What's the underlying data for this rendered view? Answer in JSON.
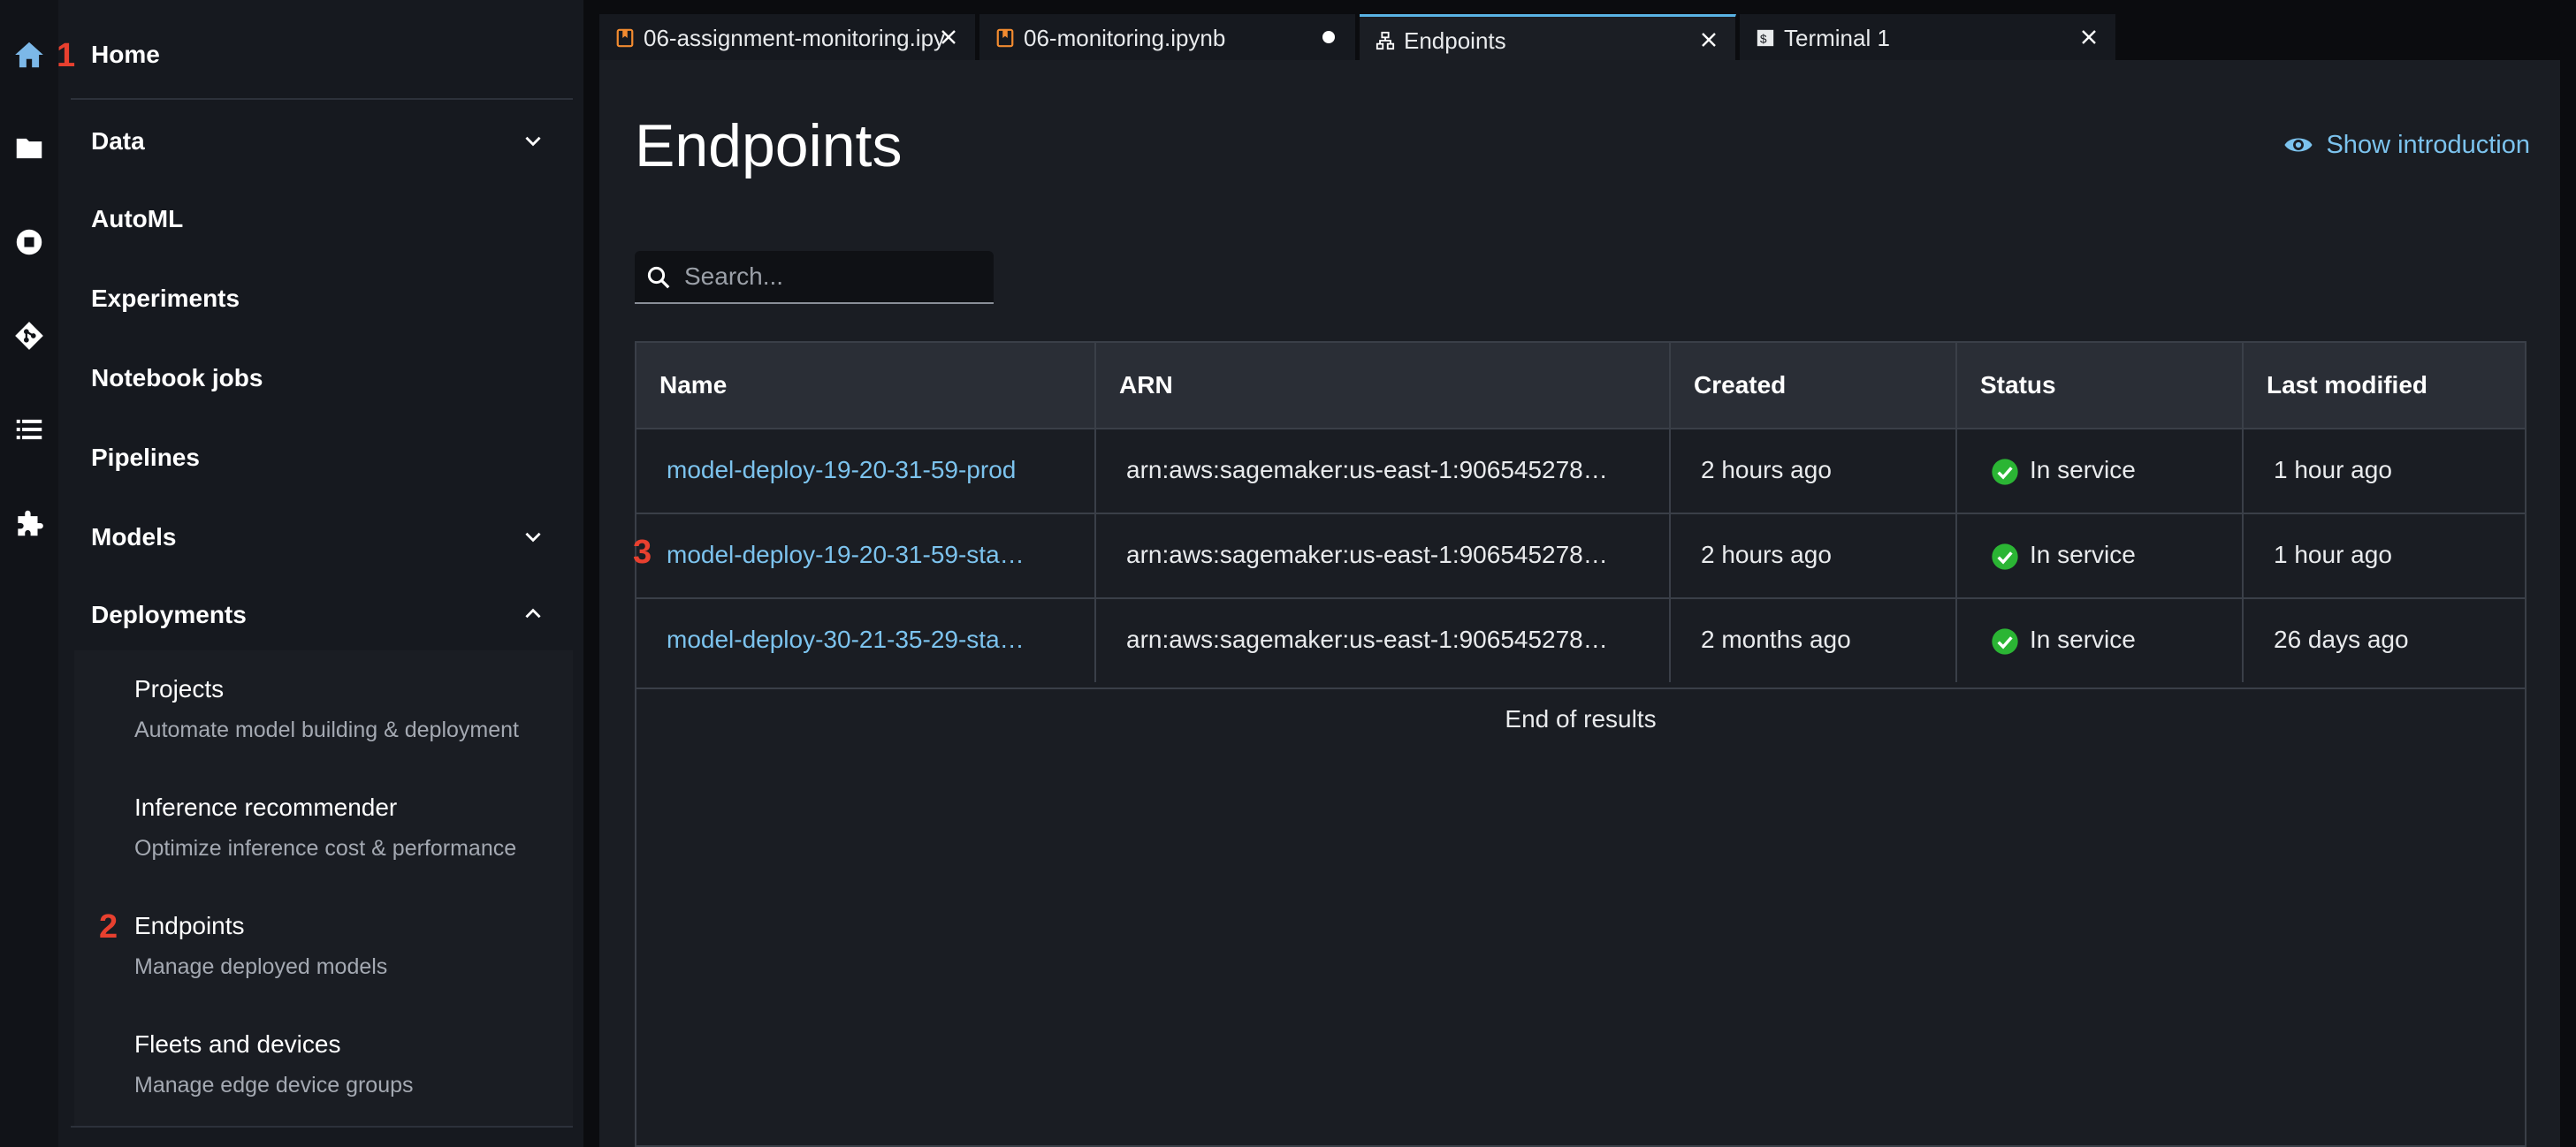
{
  "activity_bar": {
    "icons": [
      "home-icon",
      "folder-icon",
      "running-icon",
      "git-icon",
      "list-icon",
      "extension-icon"
    ]
  },
  "annotations": {
    "one": "1",
    "two": "2",
    "three": "3"
  },
  "sidebar": {
    "home_label": "Home",
    "items": [
      {
        "label": "Data",
        "chevron": "down"
      },
      {
        "label": "AutoML"
      },
      {
        "label": "Experiments"
      },
      {
        "label": "Notebook jobs"
      },
      {
        "label": "Pipelines"
      },
      {
        "label": "Models",
        "chevron": "down"
      },
      {
        "label": "Deployments",
        "chevron": "up"
      }
    ],
    "deployments_sub": [
      {
        "title": "Projects",
        "desc": "Automate model building & deployment"
      },
      {
        "title": "Inference recommender",
        "desc": "Optimize inference cost & performance"
      },
      {
        "title": "Endpoints",
        "desc": "Manage deployed models"
      },
      {
        "title": "Fleets and devices",
        "desc": "Manage edge device groups"
      }
    ]
  },
  "tabs": [
    {
      "label": "06-assignment-monitoring.ipy",
      "icon": "notebook-icon",
      "close": "×"
    },
    {
      "label": "06-monitoring.ipynb",
      "icon": "notebook-icon",
      "close": "●"
    },
    {
      "label": "Endpoints",
      "icon": "endpoints-icon",
      "close": "×",
      "active": true
    },
    {
      "label": "Terminal 1",
      "icon": "terminal-icon",
      "close": "×"
    }
  ],
  "page": {
    "title": "Endpoints",
    "show_intro": "Show introduction",
    "search_placeholder": "Search...",
    "end_of_results": "End of results"
  },
  "table": {
    "columns": [
      "Name",
      "ARN",
      "Created",
      "Status",
      "Last modified"
    ],
    "rows": [
      {
        "name": "model-deploy-19-20-31-59-prod",
        "arn": "arn:aws:sagemaker:us-east-1:906545278…",
        "created": "2 hours ago",
        "status": "In service",
        "modified": "1 hour ago"
      },
      {
        "name": "model-deploy-19-20-31-59-sta…",
        "arn": "arn:aws:sagemaker:us-east-1:906545278…",
        "created": "2 hours ago",
        "status": "In service",
        "modified": "1 hour ago"
      },
      {
        "name": "model-deploy-30-21-35-29-sta…",
        "arn": "arn:aws:sagemaker:us-east-1:906545278…",
        "created": "2 months ago",
        "status": "In service",
        "modified": "26 days ago"
      }
    ]
  },
  "colors": {
    "accent": "#59b3e4",
    "link": "#7cc3ee",
    "success": "#2bb534",
    "annotation": "#e8402f"
  }
}
